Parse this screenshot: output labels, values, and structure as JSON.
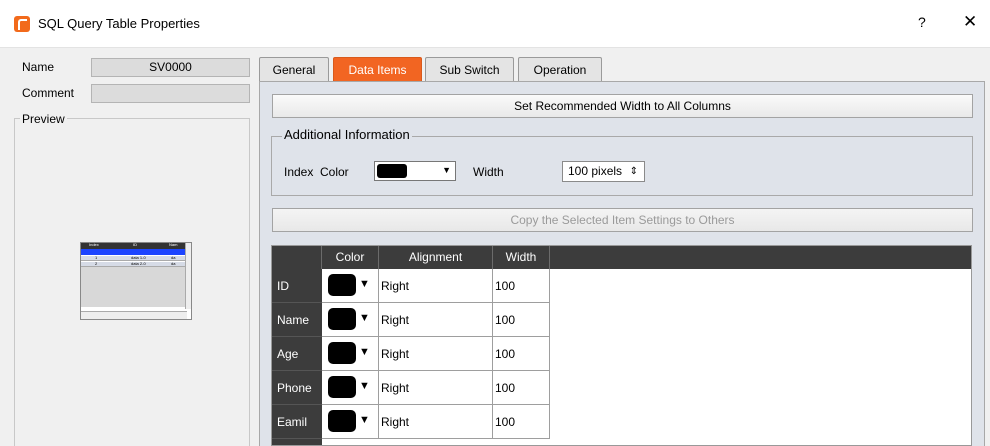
{
  "window": {
    "title": "SQL Query Table Properties",
    "help": "?",
    "close": "✕"
  },
  "props": {
    "name_label": "Name",
    "name_value": "SV0000",
    "comment_label": "Comment",
    "preview_label": "Preview"
  },
  "tabs": [
    {
      "label": "General",
      "active": false
    },
    {
      "label": "Data Items",
      "active": true
    },
    {
      "label": "Sub Switch",
      "active": false
    },
    {
      "label": "Operation",
      "active": false
    }
  ],
  "data_items": {
    "set_width_button": "Set Recommended Width to All Columns",
    "additional_info_label": "Additional Information",
    "index_label": "Index",
    "color_label": "Color",
    "width_label": "Width",
    "width_value": "100 pixels",
    "copy_button": "Copy the Selected Item Settings to Others"
  },
  "grid": {
    "columns": [
      "Color",
      "Alignment",
      "Width"
    ],
    "rows": [
      {
        "name": "ID",
        "color": "#000000",
        "alignment": "Right",
        "width": "100"
      },
      {
        "name": "Name",
        "color": "#000000",
        "alignment": "Right",
        "width": "100"
      },
      {
        "name": "Age",
        "color": "#000000",
        "alignment": "Right",
        "width": "100"
      },
      {
        "name": "Phone",
        "color": "#000000",
        "alignment": "Right",
        "width": "100"
      },
      {
        "name": "Eamil",
        "color": "#000000",
        "alignment": "Right",
        "width": "100"
      }
    ]
  },
  "mini_preview": {
    "headers": [
      "Index",
      "ID",
      "Nam"
    ],
    "rows": [
      [
        "1",
        "data 1-0",
        "da"
      ],
      [
        "2",
        "data 2-0",
        "da"
      ]
    ]
  },
  "colors": {
    "accent": "#f26522",
    "header": "#3c3c3c",
    "selection": "#1c44ff"
  }
}
